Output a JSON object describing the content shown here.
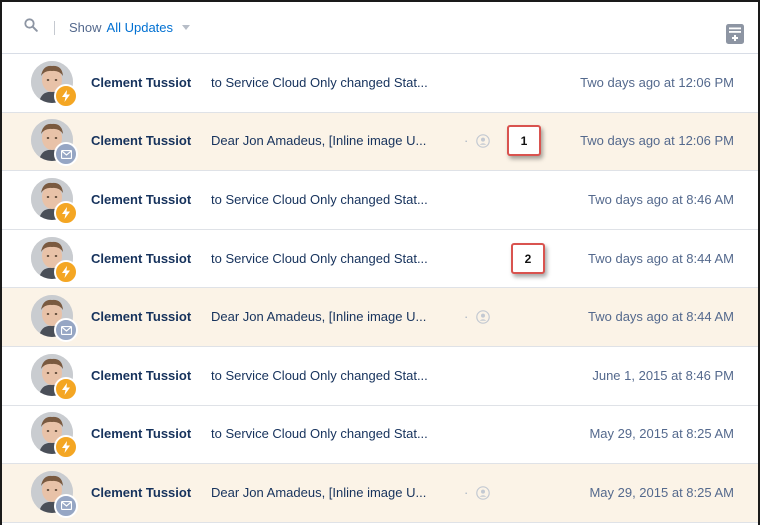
{
  "toolbar": {
    "show_label": "Show",
    "filter_value": "All Updates",
    "search_icon": "search-icon",
    "action_icon": "feed-actions-icon"
  },
  "feed": {
    "rows": [
      {
        "author": "Clement Tussiot",
        "summary": "to Service Cloud Only changed Stat...",
        "time": "Two days ago at 12:06 PM",
        "badge": "activity-icon",
        "highlight": false,
        "email": false
      },
      {
        "author": "Clement Tussiot",
        "summary": "Dear Jon Amadeus, [Inline image U...",
        "time": "Two days ago at 12:06 PM",
        "badge": "email-icon",
        "highlight": true,
        "email": true
      },
      {
        "author": "Clement Tussiot",
        "summary": "to Service Cloud Only changed Stat...",
        "time": "Two days ago at 8:46 AM",
        "badge": "activity-icon",
        "highlight": false,
        "email": false
      },
      {
        "author": "Clement Tussiot",
        "summary": "to Service Cloud Only changed Stat...",
        "time": "Two days ago at 8:44 AM",
        "badge": "activity-icon",
        "highlight": false,
        "email": false
      },
      {
        "author": "Clement Tussiot",
        "summary": "Dear Jon Amadeus, [Inline image U...",
        "time": "Two days ago at 8:44 AM",
        "badge": "email-icon",
        "highlight": true,
        "email": true
      },
      {
        "author": "Clement Tussiot",
        "summary": "to Service Cloud Only changed Stat...",
        "time": "June 1, 2015 at 8:46 PM",
        "badge": "activity-icon",
        "highlight": false,
        "email": false
      },
      {
        "author": "Clement Tussiot",
        "summary": "to Service Cloud Only changed Stat...",
        "time": "May 29, 2015 at 8:25 AM",
        "badge": "activity-icon",
        "highlight": false,
        "email": false
      },
      {
        "author": "Clement Tussiot",
        "summary": "Dear Jon Amadeus, [Inline image U...",
        "time": "May 29, 2015 at 8:25 AM",
        "badge": "email-icon",
        "highlight": true,
        "email": true
      }
    ]
  },
  "callouts": [
    "1",
    "2"
  ],
  "colors": {
    "highlight_row": "#fbf3e7",
    "activity_badge": "#f4a623",
    "email_badge": "#96a6c4",
    "link": "#0070d2",
    "callout_border": "#d9534f"
  }
}
